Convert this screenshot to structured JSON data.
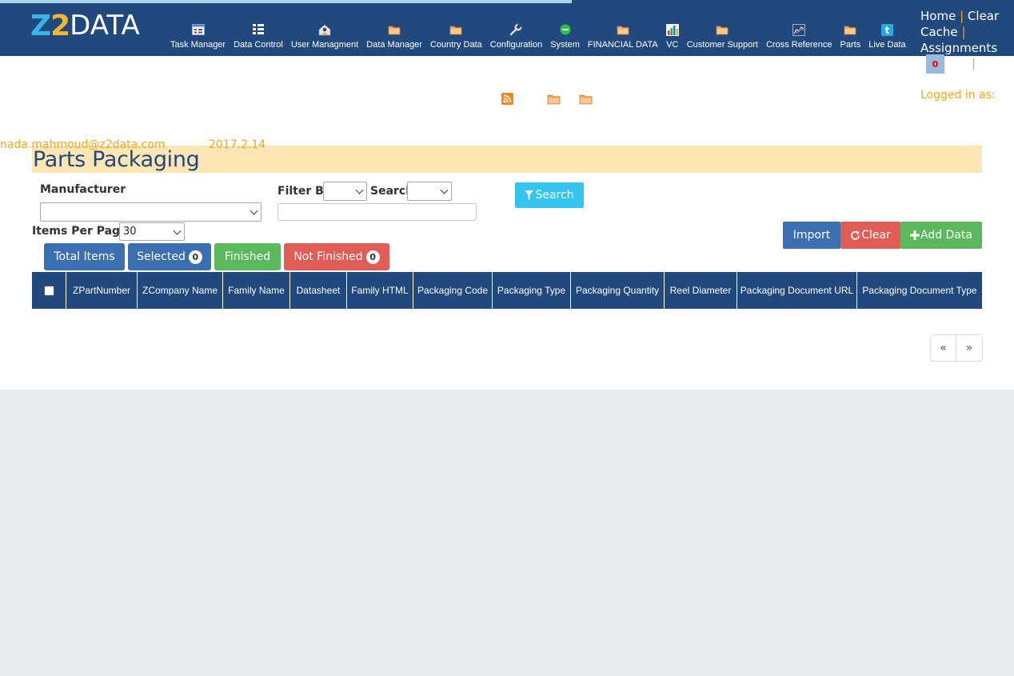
{
  "app": {
    "logo": {
      "z": "Z",
      "two": "2",
      "text": "DATA"
    }
  },
  "nav": [
    {
      "label": "Task Manager",
      "icon": "task-manager-icon"
    },
    {
      "label": "Data Control",
      "icon": "data-control-icon"
    },
    {
      "label": "User Managment",
      "icon": "user-management-icon"
    },
    {
      "label": "Data Manager",
      "icon": "folder-icon"
    },
    {
      "label": "Country Data",
      "icon": "folder-icon"
    },
    {
      "label": "Configuration",
      "icon": "wrench-icon"
    },
    {
      "label": "System",
      "icon": "green-dot-icon"
    },
    {
      "label": "FINANCIAL DATA",
      "icon": "folder-icon"
    },
    {
      "label": "VC",
      "icon": "bar-chart-icon"
    },
    {
      "label": "Customer Support",
      "icon": "folder-icon"
    },
    {
      "label": "Cross Reference",
      "icon": "line-chart-icon"
    },
    {
      "label": "Parts",
      "icon": "folder-icon"
    },
    {
      "label": "Live Data",
      "icon": "twitter-icon"
    }
  ],
  "top_links": {
    "home": "Home",
    "clear_cache": "Clear Cache",
    "assignments": "Assignments",
    "separator": "|"
  },
  "notifications": {
    "count": "0"
  },
  "logged_in_label": "Logged in as:",
  "user": {
    "email": "nada.mahmoud@z2data.com",
    "version": "2017.2.14"
  },
  "page": {
    "title": "Parts Packaging"
  },
  "filters": {
    "manufacturer_label": "Manufacturer",
    "manufacturer_value": "",
    "filter_by_label": "Filter By",
    "filter_by_value": "",
    "search_label": "Search",
    "search_value": "",
    "search_text": "",
    "items_per_page_label": "Items Per Page",
    "items_per_page_value": "30"
  },
  "buttons": {
    "search": "Search",
    "import": "Import",
    "clear": "Clear",
    "add_data": "Add Data"
  },
  "tabs": {
    "total": "Total Items",
    "selected": "Selected",
    "selected_count": "0",
    "finished": "Finished",
    "not_finished": "Not Finished",
    "not_finished_count": "0"
  },
  "columns": [
    "ZPartNumber",
    "ZCompany Name",
    "Family Name",
    "Datasheet",
    "Family HTML",
    "Packaging Code",
    "Packaging Type",
    "Packaging Quantity",
    "Reel Diameter",
    "Packaging Document URL",
    "Packaging Document Type"
  ],
  "pager": {
    "prev": "«",
    "next": "»"
  },
  "colors": {
    "nav_bg": "#22497d",
    "accent_orange": "#f0a81c",
    "title_bg": "#fde5b4",
    "primary": "#3a6fb0",
    "danger": "#e05d57",
    "success": "#5cb85c",
    "info": "#35c4ed"
  }
}
